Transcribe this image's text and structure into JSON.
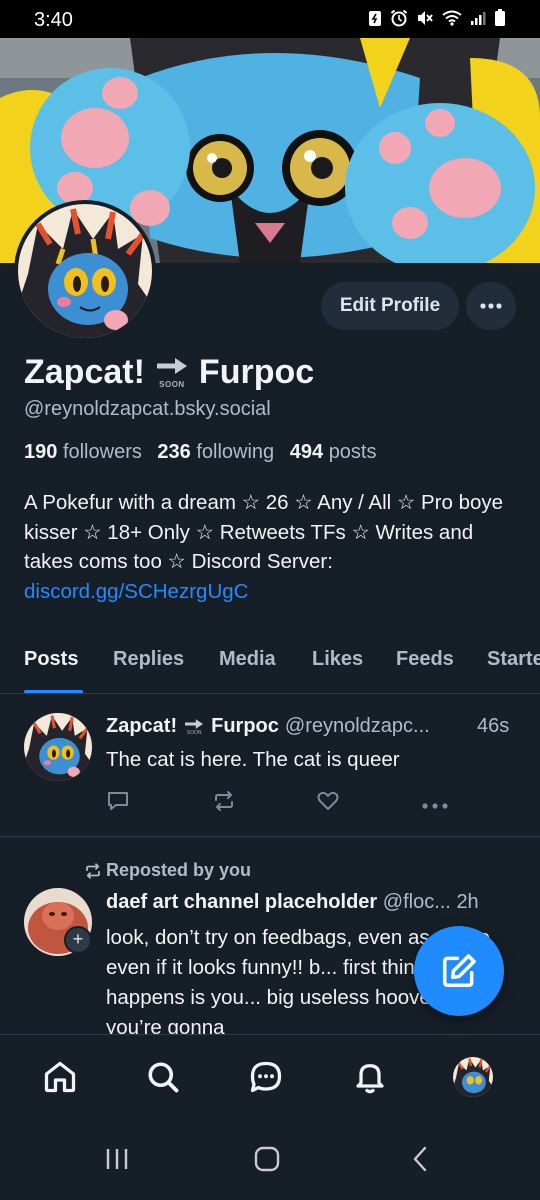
{
  "status_bar": {
    "time": "3:40",
    "icons": [
      "battery-saver-icon",
      "alarm-icon",
      "mute-icon",
      "wifi-icon",
      "signal-icon",
      "battery-icon"
    ]
  },
  "profile": {
    "edit_label": "Edit Profile",
    "more_label": "•••",
    "name_part1": "Zapcat!",
    "name_badge_text": "SOON",
    "name_part2": "Furpoc",
    "handle": "@reynoldzapcat.bsky.social",
    "followers_count": "190",
    "followers_label": "followers",
    "following_count": "236",
    "following_label": "following",
    "posts_count": "494",
    "posts_label": "posts",
    "bio_text": "A Pokefur with a dream ☆ 26 ☆ Any / All ☆ Pro boye kisser ☆ 18+ Only ☆ Retweets TFs ☆ Writes and takes coms too ☆ Discord Server: ",
    "bio_link": "discord.gg/SCHezrgUgC"
  },
  "tabs": [
    "Posts",
    "Replies",
    "Media",
    "Likes",
    "Feeds",
    "Starte"
  ],
  "posts": [
    {
      "author_name": "Zapcat!",
      "badge_text": "SOON",
      "author_name2": "Furpoc",
      "handle": "@reynoldzapc...",
      "time": "46s",
      "text": "The cat is here. The cat is queer"
    },
    {
      "repost_label": "Reposted by you",
      "author_name": "daef art channel placeholder",
      "handle": "@floc...",
      "time": "2h",
      "text": "look, don’t try on feedbags, even as a joke, even if it looks funny!! b... first think that happens is you... big useless hooves and you’re gonna"
    }
  ],
  "colors": {
    "background": "#161e27",
    "accent": "#208bfe",
    "muted_text": "#aebbc9",
    "button_bg": "#212d3b"
  },
  "bottom_nav": [
    "home-icon",
    "search-icon",
    "chat-icon",
    "bell-icon",
    "profile-avatar"
  ]
}
